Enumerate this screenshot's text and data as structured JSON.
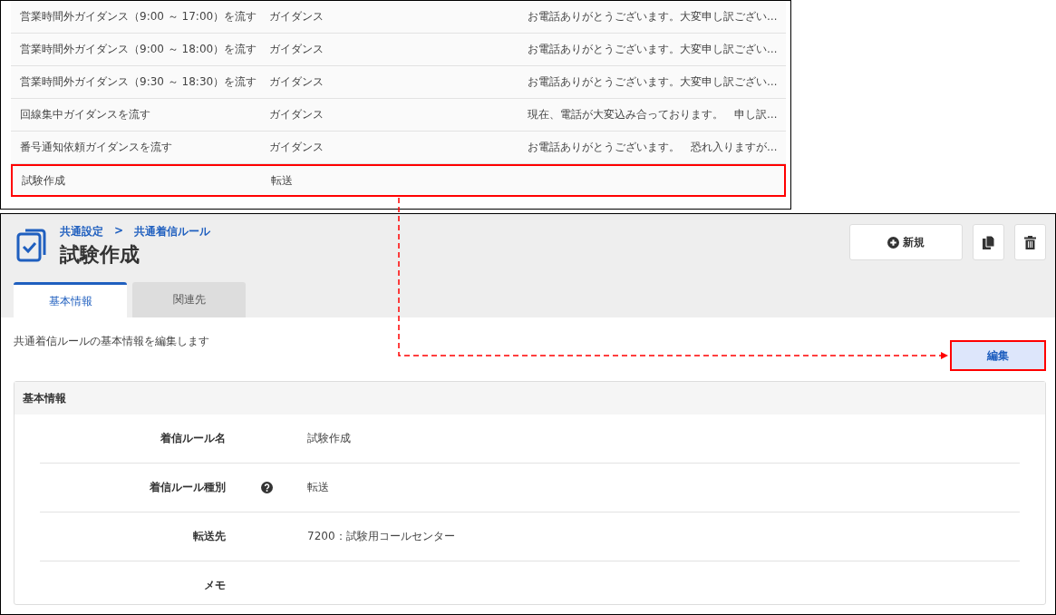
{
  "list": {
    "rows": [
      {
        "name": "営業時間外ガイダンス（9:00 ～ 17:00）を流す",
        "type": "ガイダンス",
        "message": "お電話ありがとうございます。大変申し訳ござい…",
        "highlighted": false
      },
      {
        "name": "営業時間外ガイダンス（9:00 ～ 18:00）を流す",
        "type": "ガイダンス",
        "message": "お電話ありがとうございます。大変申し訳ござい…",
        "highlighted": false
      },
      {
        "name": "営業時間外ガイダンス（9:30 ～ 18:30）を流す",
        "type": "ガイダンス",
        "message": "お電話ありがとうございます。大変申し訳ござい…",
        "highlighted": false
      },
      {
        "name": "回線集中ガイダンスを流す",
        "type": "ガイダンス",
        "message": "現在、電話が大変込み合っております。　申し訳…",
        "highlighted": false
      },
      {
        "name": "番号通知依頼ガイダンスを流す",
        "type": "ガイダンス",
        "message": "お電話ありがとうございます。　恐れ入りますが…",
        "highlighted": false
      },
      {
        "name": "試験作成",
        "type": "転送",
        "highlighted": true
      }
    ]
  },
  "header": {
    "breadcrumb": [
      "共通設定",
      "共通着信ルール"
    ],
    "separator": ">",
    "title": "試験作成",
    "new_button": "新規"
  },
  "tabs": [
    {
      "label": "基本情報",
      "selected": true
    },
    {
      "label": "関連先",
      "selected": false
    }
  ],
  "description": "共通着信ルールの基本情報を編集します",
  "edit_button": {
    "label": "編集",
    "highlighted": true
  },
  "card": {
    "title": "基本情報",
    "fields": [
      {
        "label": "着信ルール名",
        "value": "試験作成",
        "help": false
      },
      {
        "label": "着信ルール種別",
        "value": "転送",
        "help": true
      },
      {
        "label": "転送先",
        "value": "7200：試験用コールセンター",
        "help": false
      },
      {
        "label": "メモ",
        "help": false
      }
    ]
  }
}
